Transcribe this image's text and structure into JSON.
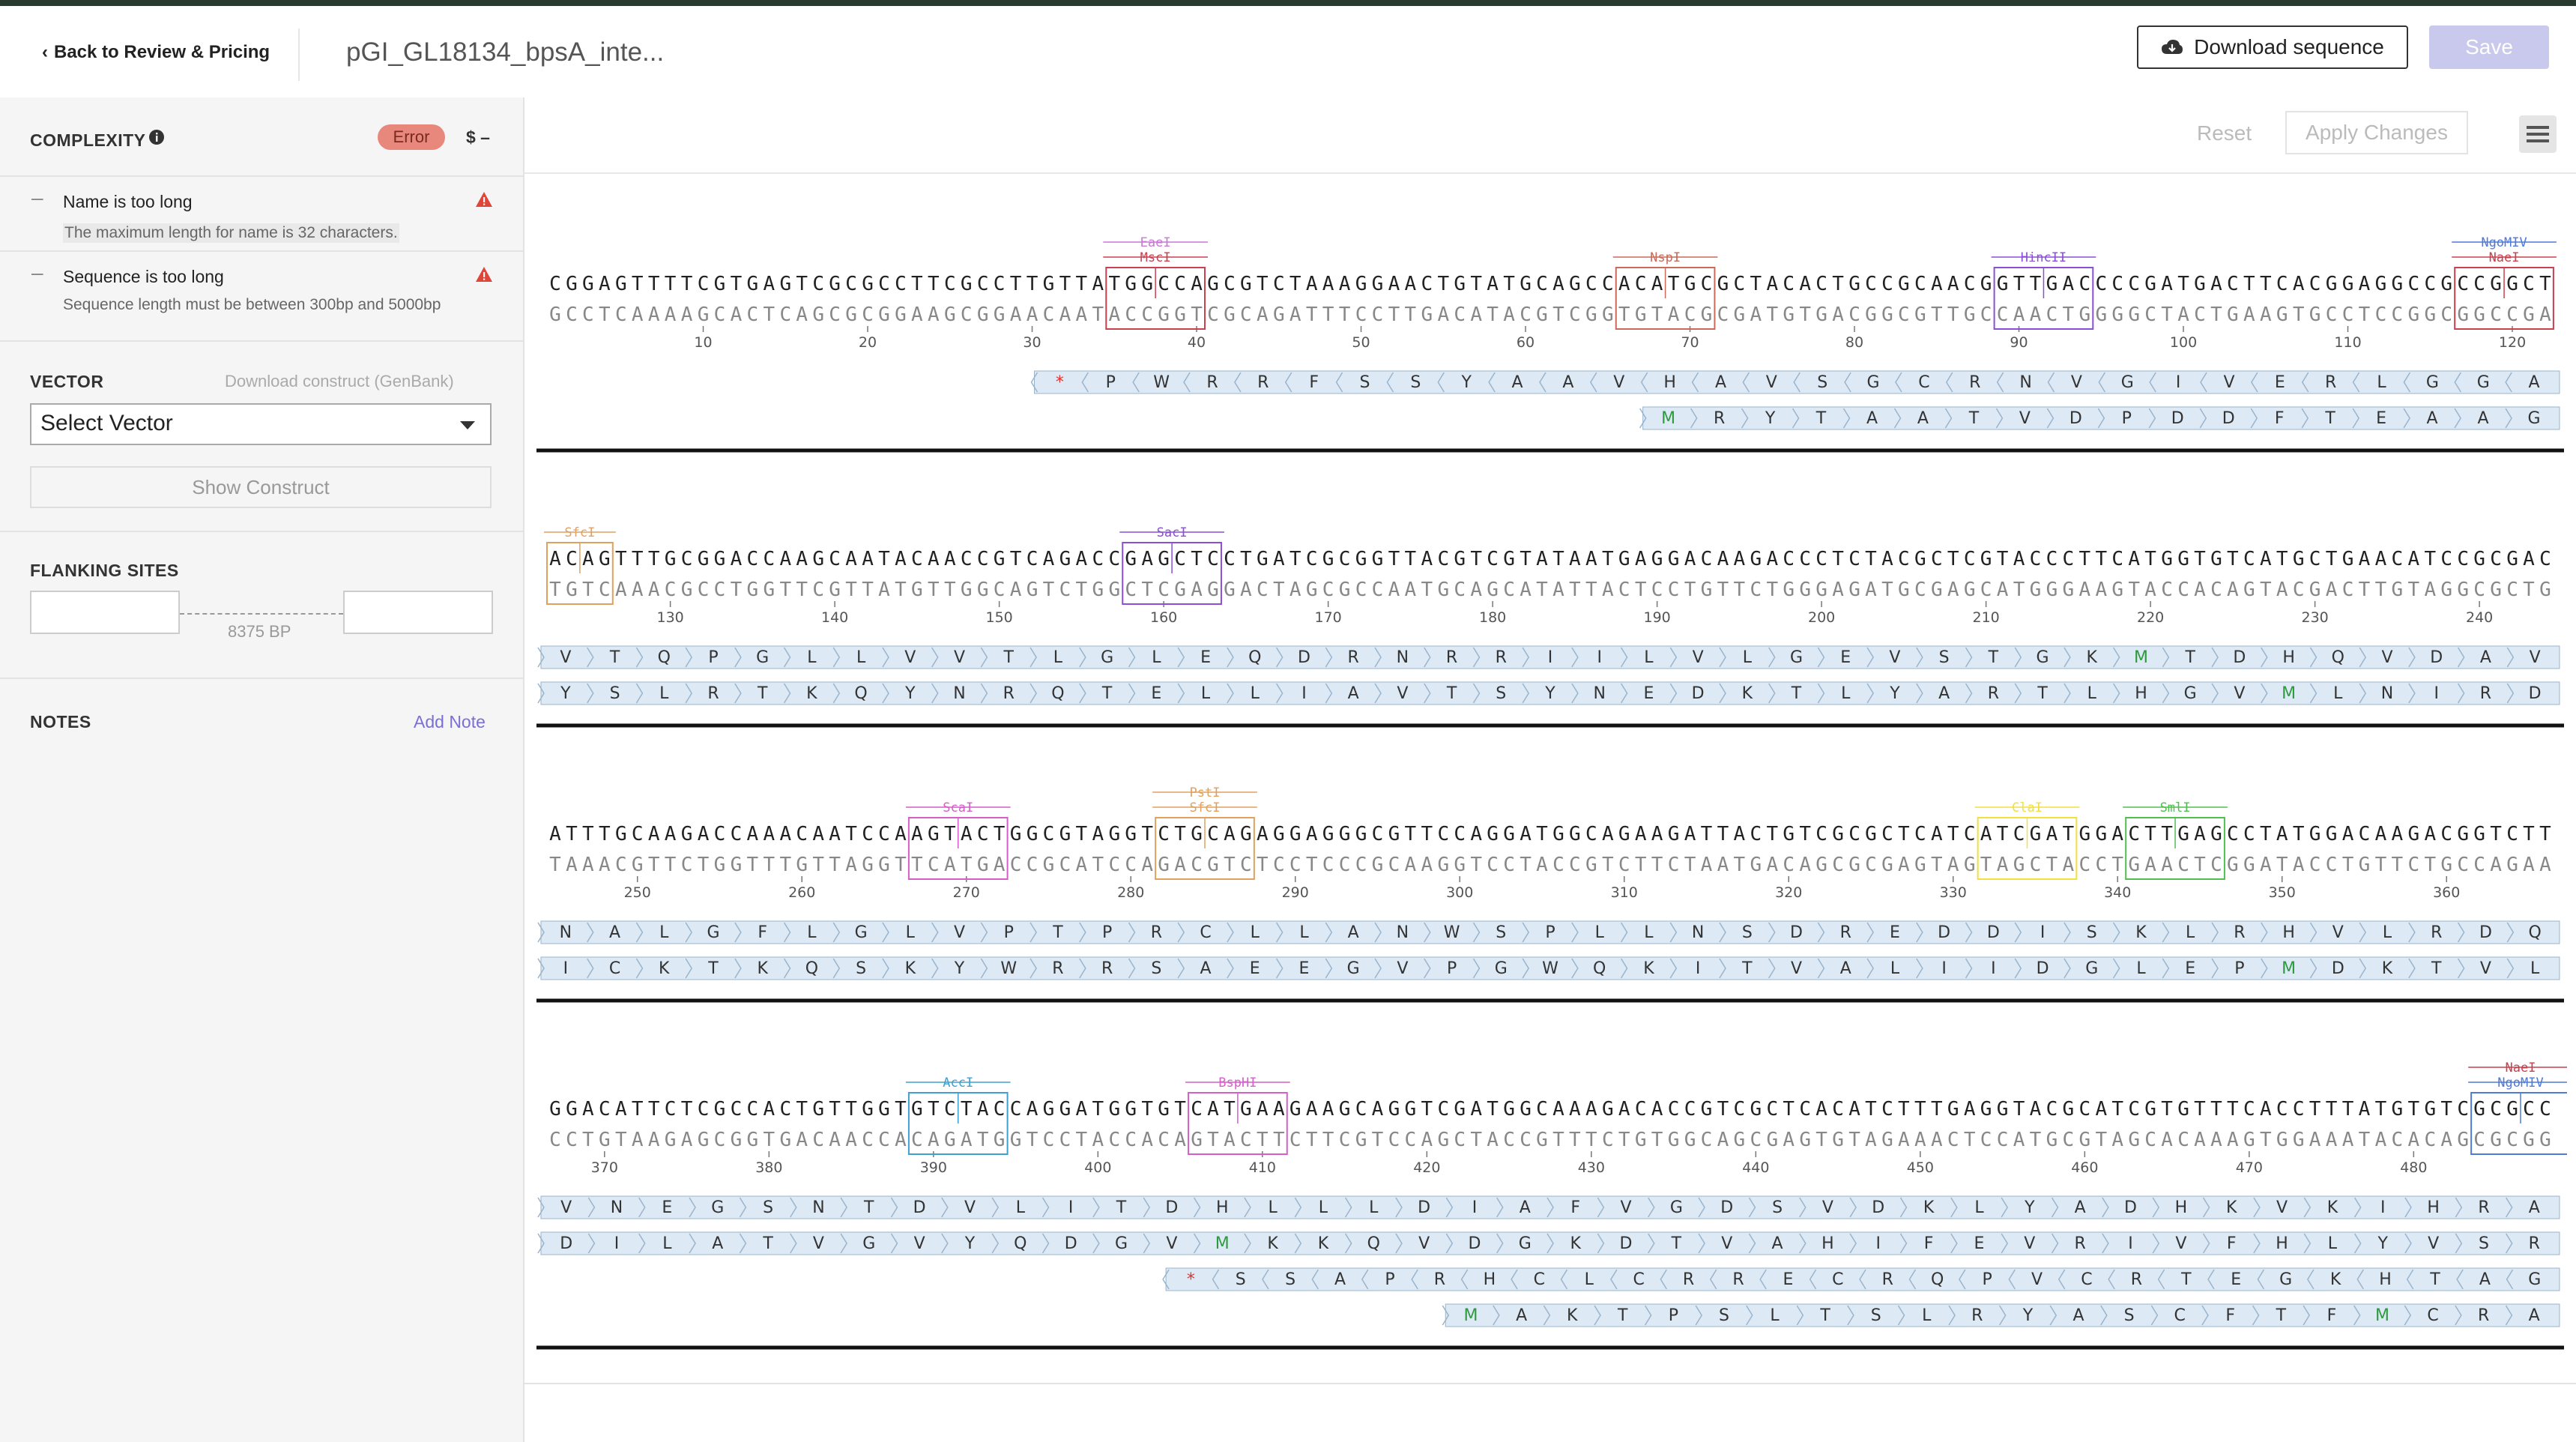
{
  "header": {
    "back_label": "Back to Review & Pricing",
    "title": "pGI_GL18134_bpsA_inte...",
    "download_label": "Download sequence",
    "save_label": "Save"
  },
  "complexity": {
    "label": "COMPLEXITY",
    "status": "Error",
    "price": "$ –",
    "errors": [
      {
        "title": "Name is too long",
        "message": "The maximum length for name is 32 characters."
      },
      {
        "title": "Sequence is too long",
        "message": "Sequence length must be between 300bp and 5000bp"
      }
    ]
  },
  "vector": {
    "label": "VECTOR",
    "download_link": "Download construct (GenBank)",
    "select_value": "Select Vector",
    "show_button": "Show Construct"
  },
  "flanking": {
    "label": "FLANKING SITES",
    "length": "8375 BP",
    "left_value": "",
    "right_value": ""
  },
  "notes": {
    "label": "NOTES",
    "add_label": "Add Note"
  },
  "toolbar": {
    "reset_label": "Reset",
    "apply_label": "Apply Changes"
  },
  "colors": {
    "accent": "#7a6fd6",
    "error_badge": "#e8877b",
    "save_disabled": "#c8c9ec",
    "translation_fill": "#dde9f5",
    "stop_codon": "#e0312f",
    "start_codon": "#2e9a3e"
  },
  "sequence": {
    "rows": [
      {
        "start": 1,
        "top": "CGGAGTTTTCGTGAGTCGCGCCTTCGCCTTGTTATGGCCAGCGTCTAAAGGAACTGTATGCAGCCACATGCGCTACACTGCCGCAACGGTTGACCCCGATGACTTCACGGAGGCCGCCGGCT",
        "bottom": "GCCTCAAAAGCACTCAGCGCGGAAGCGGAACAATACCGGTCGCAGATTTCCTTGACATACGTCGGTGTACGCGATGTGACGGCGTTGCCAACTGGGGCTACTGAAGTGCCTCCGGCGGCCGA",
        "ticks": [
          10,
          20,
          30,
          40,
          50,
          60,
          70,
          80,
          90,
          100,
          110,
          120
        ],
        "sites": [
          {
            "names": [
              "EaeI",
              "MscI"
            ],
            "start": 35,
            "len": 6,
            "colors": [
              "#c978d6",
              "#c9404f"
            ]
          },
          {
            "names": [
              "NspI"
            ],
            "start": 66,
            "len": 6,
            "colors": [
              "#c96a5a"
            ]
          },
          {
            "names": [
              "HincII"
            ],
            "start": 89,
            "len": 6,
            "colors": [
              "#8a4fd6"
            ]
          },
          {
            "names": [
              "NgoMIV",
              "NaeI"
            ],
            "start": 117,
            "len": 6,
            "colors": [
              "#4f7ad6",
              "#c9404f"
            ]
          }
        ],
        "frames": [
          {
            "from": 31,
            "dir": "left",
            "aa": "*PWRRFSSYAAVHAVSGCRNVGIVERLGGA"
          },
          {
            "from": 68,
            "dir": "right",
            "aa": "MRYTAATVDPDDFTEAAG"
          }
        ]
      },
      {
        "start": 123,
        "top": "ACAGTTTGCGGACCAAGCAATACAACCGTCAGACCGAGCTCCTGATCGCGGTTACGTCGTATAATGAGGACAAGACCCTCTACGCTCGTACCCTTCATGGTGTCATGCTGAACATCCGCGAC",
        "bottom": "TGTCAAACGCCTGGTTCGTTATGTTGGCAGTCTGGCTCGAGGACTAGCGCCAATGCAGCATATTACTCCTGTTCTGGGAGATGCGAGCATGGGAAGTACCACAGTACGACTTGTAGGCGCTG",
        "ticks": [
          130,
          140,
          150,
          160,
          170,
          180,
          190,
          200,
          210,
          220,
          230,
          240
        ],
        "sites": [
          {
            "names": [
              "SfcI"
            ],
            "start": 123,
            "len": 4,
            "colors": [
              "#e0a060"
            ]
          },
          {
            "names": [
              "SacI"
            ],
            "start": 158,
            "len": 6,
            "colors": [
              "#8a4fd6"
            ]
          }
        ],
        "frames": [
          {
            "from": 1,
            "dir": "right",
            "aa": "VTQPGLLVVTLGLEQDRNRRIILVLGEVSTGKMTDHQVDAV"
          },
          {
            "from": 1,
            "dir": "right",
            "aa": "YSLRTKQYNRQTELLIAVTSYNEDKTLYARTLHGVMLNIRD"
          }
        ]
      },
      {
        "start": 245,
        "top": "ATTTGCAAGACCAAACAATCCAAGTACTGGCGTAGGTCTGCAGAGGAGGGCGTTCCAGGATGGCAGAAGATTACTGTCGCGCTCATCATCGATGGACTTGAGCCTATGGACAAGACGGTCTT",
        "bottom": "TAAACGTTCTGGTTTGTTAGGTTCATGACCGCATCCAGACGTCTCCTCCCGCAAGGTCCTACCGTCTTCTAATGACAGCGCGAGTAGTAGCTACCTGAACTCGGATACCTGTTCTGCCAGAA",
        "ticks": [
          250,
          260,
          270,
          280,
          290,
          300,
          310,
          320,
          330,
          340,
          350,
          360
        ],
        "sites": [
          {
            "names": [
              "ScaI"
            ],
            "start": 267,
            "len": 6,
            "colors": [
              "#d45fc9"
            ]
          },
          {
            "names": [
              "PstI",
              "SfcI"
            ],
            "start": 282,
            "len": 6,
            "colors": [
              "#e0a060",
              "#e0a060"
            ]
          },
          {
            "names": [
              "ClaI"
            ],
            "start": 332,
            "len": 6,
            "colors": [
              "#f0e040"
            ]
          },
          {
            "names": [
              "SmlI"
            ],
            "start": 341,
            "len": 6,
            "colors": [
              "#4fbf4f"
            ]
          }
        ],
        "frames": [
          {
            "from": 1,
            "dir": "right",
            "aa": "NALGFLGLVPTPRCLLANWSPLLNSDREDDISKLRHVLRDQ"
          },
          {
            "from": 1,
            "dir": "right",
            "aa": "ICKTKQSKYWRRSAEEGVPGWQKITVALIIDGLEPMDKTVL"
          }
        ]
      },
      {
        "start": 367,
        "top": "GGACATTCTCGCCACTGTTGGTGTCTACCAGGATGGTGTCATGAAGAAGCAGGTCGATGGCAAAGACACCGTCGCTCACATCTTTGAGGTACGCATCGTGTTTCACCTTTATGTGTCGCGCC",
        "bottom": "CCTGTAAGAGCGGTGACAACCACAGATGGTCCTACCACAGTACTTCTTCGTCCAGCTACCGTTTCTGTGGCAGCGAGTGTAGAAACTCCATGCGTAGCACAAAGTGGAAATACACAGCGCGG",
        "ticks": [
          370,
          380,
          390,
          400,
          410,
          420,
          430,
          440,
          450,
          460,
          470,
          480
        ],
        "sites": [
          {
            "names": [
              "AccI"
            ],
            "start": 389,
            "len": 6,
            "colors": [
              "#3fa0d0"
            ]
          },
          {
            "names": [
              "BspHI"
            ],
            "start": 406,
            "len": 6,
            "colors": [
              "#d45fc9"
            ]
          },
          {
            "names": [
              "NaeI",
              "NgoMIV"
            ],
            "start": 484,
            "len": 6,
            "colors": [
              "#c9404f",
              "#4f7ad6"
            ]
          }
        ],
        "frames": [
          {
            "from": 1,
            "dir": "right",
            "aa": "VNEGSNTDVLITDHLLLDIAFVGDSVDKLYADHKVKIHRA"
          },
          {
            "from": 1,
            "dir": "right",
            "aa": "DILATVGVYQDGVMKKQVDGKDTVAHIFEVRIVFHLYVSR"
          },
          {
            "from": 39,
            "dir": "left",
            "aa": "*SSAPRHCLCRRECRQPVCRTEGKHTAG"
          },
          {
            "from": 56,
            "dir": "right",
            "aa": "MAKTPSLTSLRYASCFTFMCRA"
          }
        ]
      }
    ]
  }
}
